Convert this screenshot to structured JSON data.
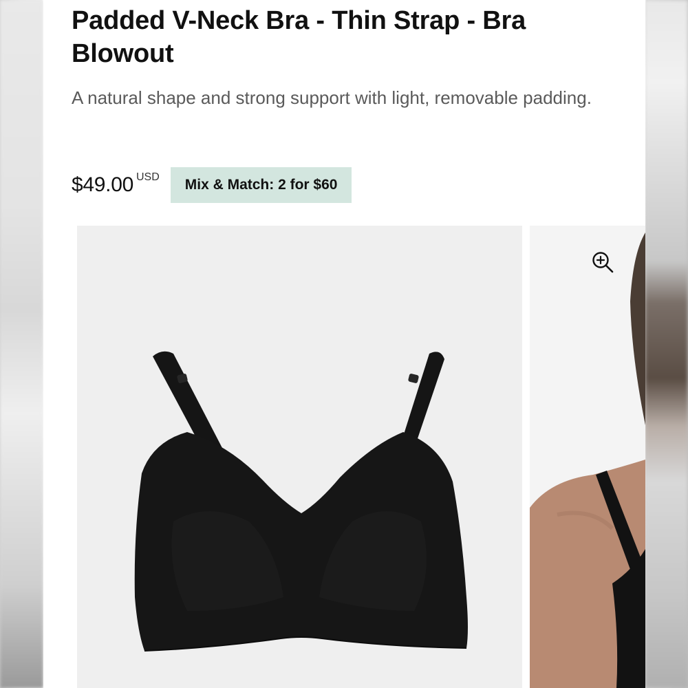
{
  "product": {
    "title": "Padded V-Neck Bra - Thin Strap - Bra Blowout",
    "description": "A natural shape and strong support with light, removable padding.",
    "price": "$49.00",
    "currency": "USD",
    "promo_badge": "Mix & Match: 2 for $60"
  },
  "gallery": {
    "main_image": "black-padded-bra-product-photo",
    "side_image": "model-wearing-bra-photo",
    "zoom_icon": "zoom-in-icon"
  },
  "colors": {
    "badge_bg": "#d3e6df",
    "image_bg": "#efefef",
    "text_primary": "#111111",
    "text_secondary": "#5a5a5a"
  }
}
